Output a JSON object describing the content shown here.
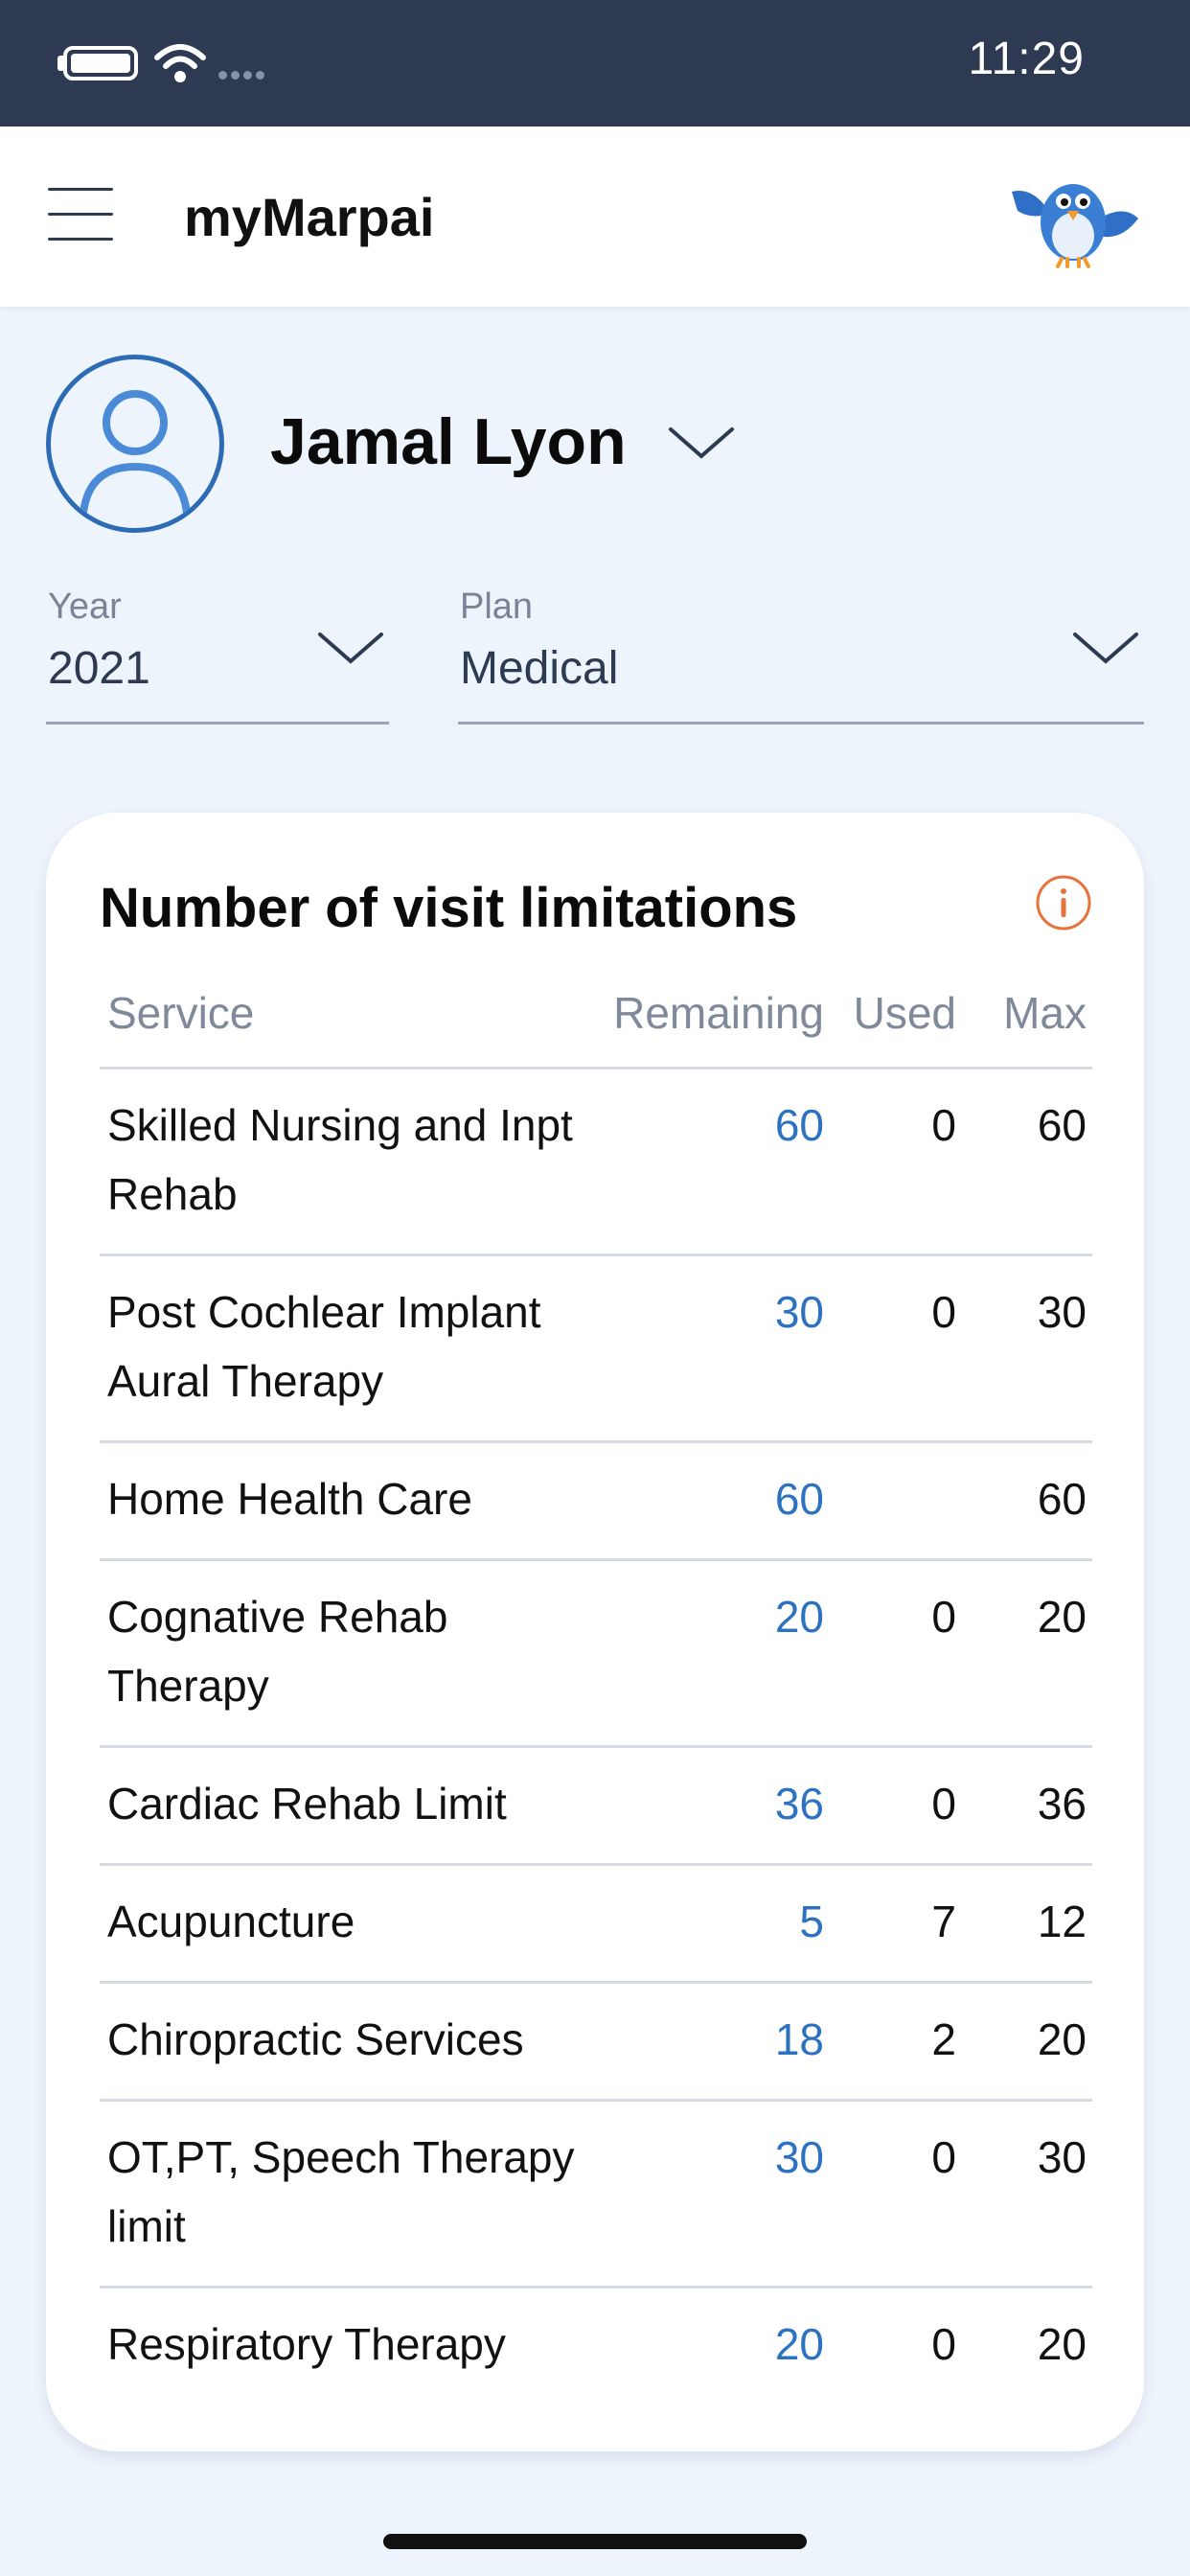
{
  "status_bar": {
    "time": "11:29",
    "icons": [
      "battery-icon",
      "wifi-icon",
      "signal-icon"
    ]
  },
  "header": {
    "app_title": "myMarpai",
    "icons": [
      "menu-icon",
      "bird-logo-icon"
    ]
  },
  "profile": {
    "name": "Jamal Lyon"
  },
  "filters": {
    "year": {
      "label": "Year",
      "value": "2021"
    },
    "plan": {
      "label": "Plan",
      "value": "Medical"
    }
  },
  "card": {
    "title": "Number of visit limitations",
    "columns": {
      "service": "Service",
      "remaining": "Remaining",
      "used": "Used",
      "max": "Max"
    },
    "rows": [
      {
        "service": "Skilled Nursing and Inpt Rehab",
        "remaining": "60",
        "used": "0",
        "max": "60"
      },
      {
        "service": "Post Cochlear Implant Aural Therapy",
        "remaining": "30",
        "used": "0",
        "max": "30"
      },
      {
        "service": "Home Health Care",
        "remaining": "60",
        "used": "",
        "max": "60"
      },
      {
        "service": "Cognative Rehab Therapy",
        "remaining": "20",
        "used": "0",
        "max": "20"
      },
      {
        "service": "Cardiac Rehab Limit",
        "remaining": "36",
        "used": "0",
        "max": "36"
      },
      {
        "service": "Acupuncture",
        "remaining": "5",
        "used": "7",
        "max": "12"
      },
      {
        "service": "Chiropractic Services",
        "remaining": "18",
        "used": "2",
        "max": "20"
      },
      {
        "service": "OT,PT, Speech Therapy limit",
        "remaining": "30",
        "used": "0",
        "max": "30"
      },
      {
        "service": "Respiratory Therapy",
        "remaining": "20",
        "used": "0",
        "max": "20"
      }
    ]
  },
  "colors": {
    "status_bar_bg": "#2e3a52",
    "page_bg": "#eef4fc",
    "accent_blue": "#2d72c0",
    "info_orange": "#e8733a"
  }
}
